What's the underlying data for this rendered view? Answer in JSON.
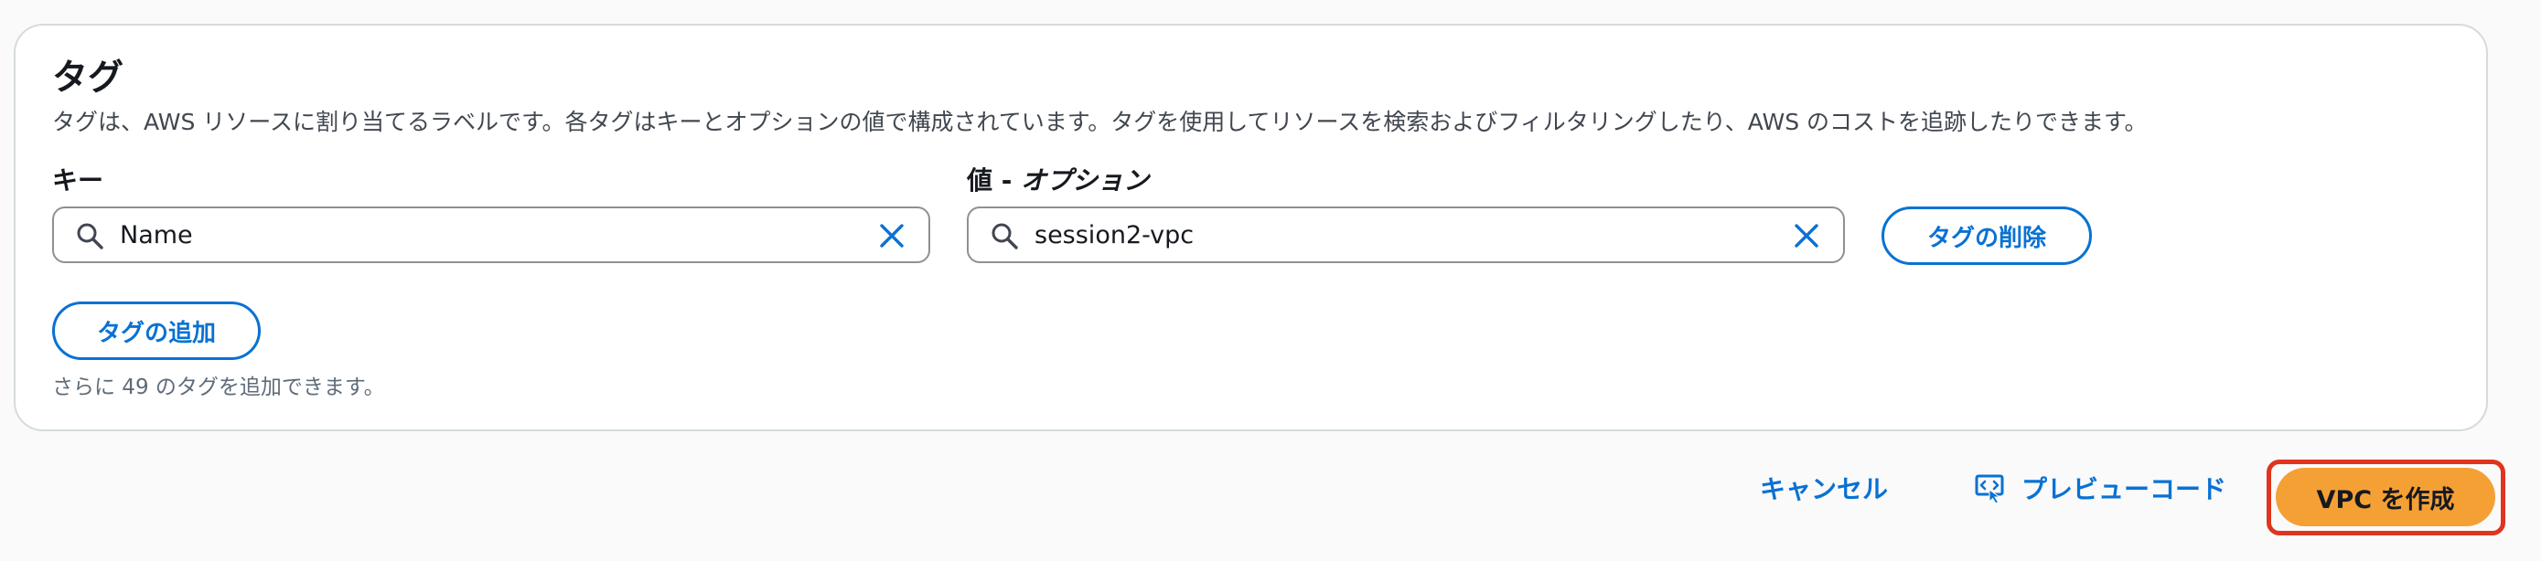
{
  "tags_section": {
    "title": "タグ",
    "description": "タグは、AWS リソースに割り当てるラベルです。各タグはキーとオプションの値で構成されています。タグを使用してリソースを検索およびフィルタリングしたり、AWS のコストを追跡したりできます。",
    "key_label": "キー",
    "value_label_main": "値 - ",
    "value_label_optional": "オプション",
    "tag": {
      "key": "Name",
      "value": "session2-vpc"
    },
    "remove_tag_label": "タグの削除",
    "add_tag_label": "タグの追加",
    "remaining_hint": "さらに 49 のタグを追加できます。"
  },
  "footer": {
    "cancel_label": "キャンセル",
    "preview_code_label": "プレビューコード",
    "create_label": "VPC を作成"
  },
  "icons": {
    "search": "search-icon",
    "clear": "close-icon",
    "preview": "preview-code-icon"
  },
  "colors": {
    "link": "#0972d3",
    "primary": "#f5a035",
    "highlight": "#e0341e"
  }
}
